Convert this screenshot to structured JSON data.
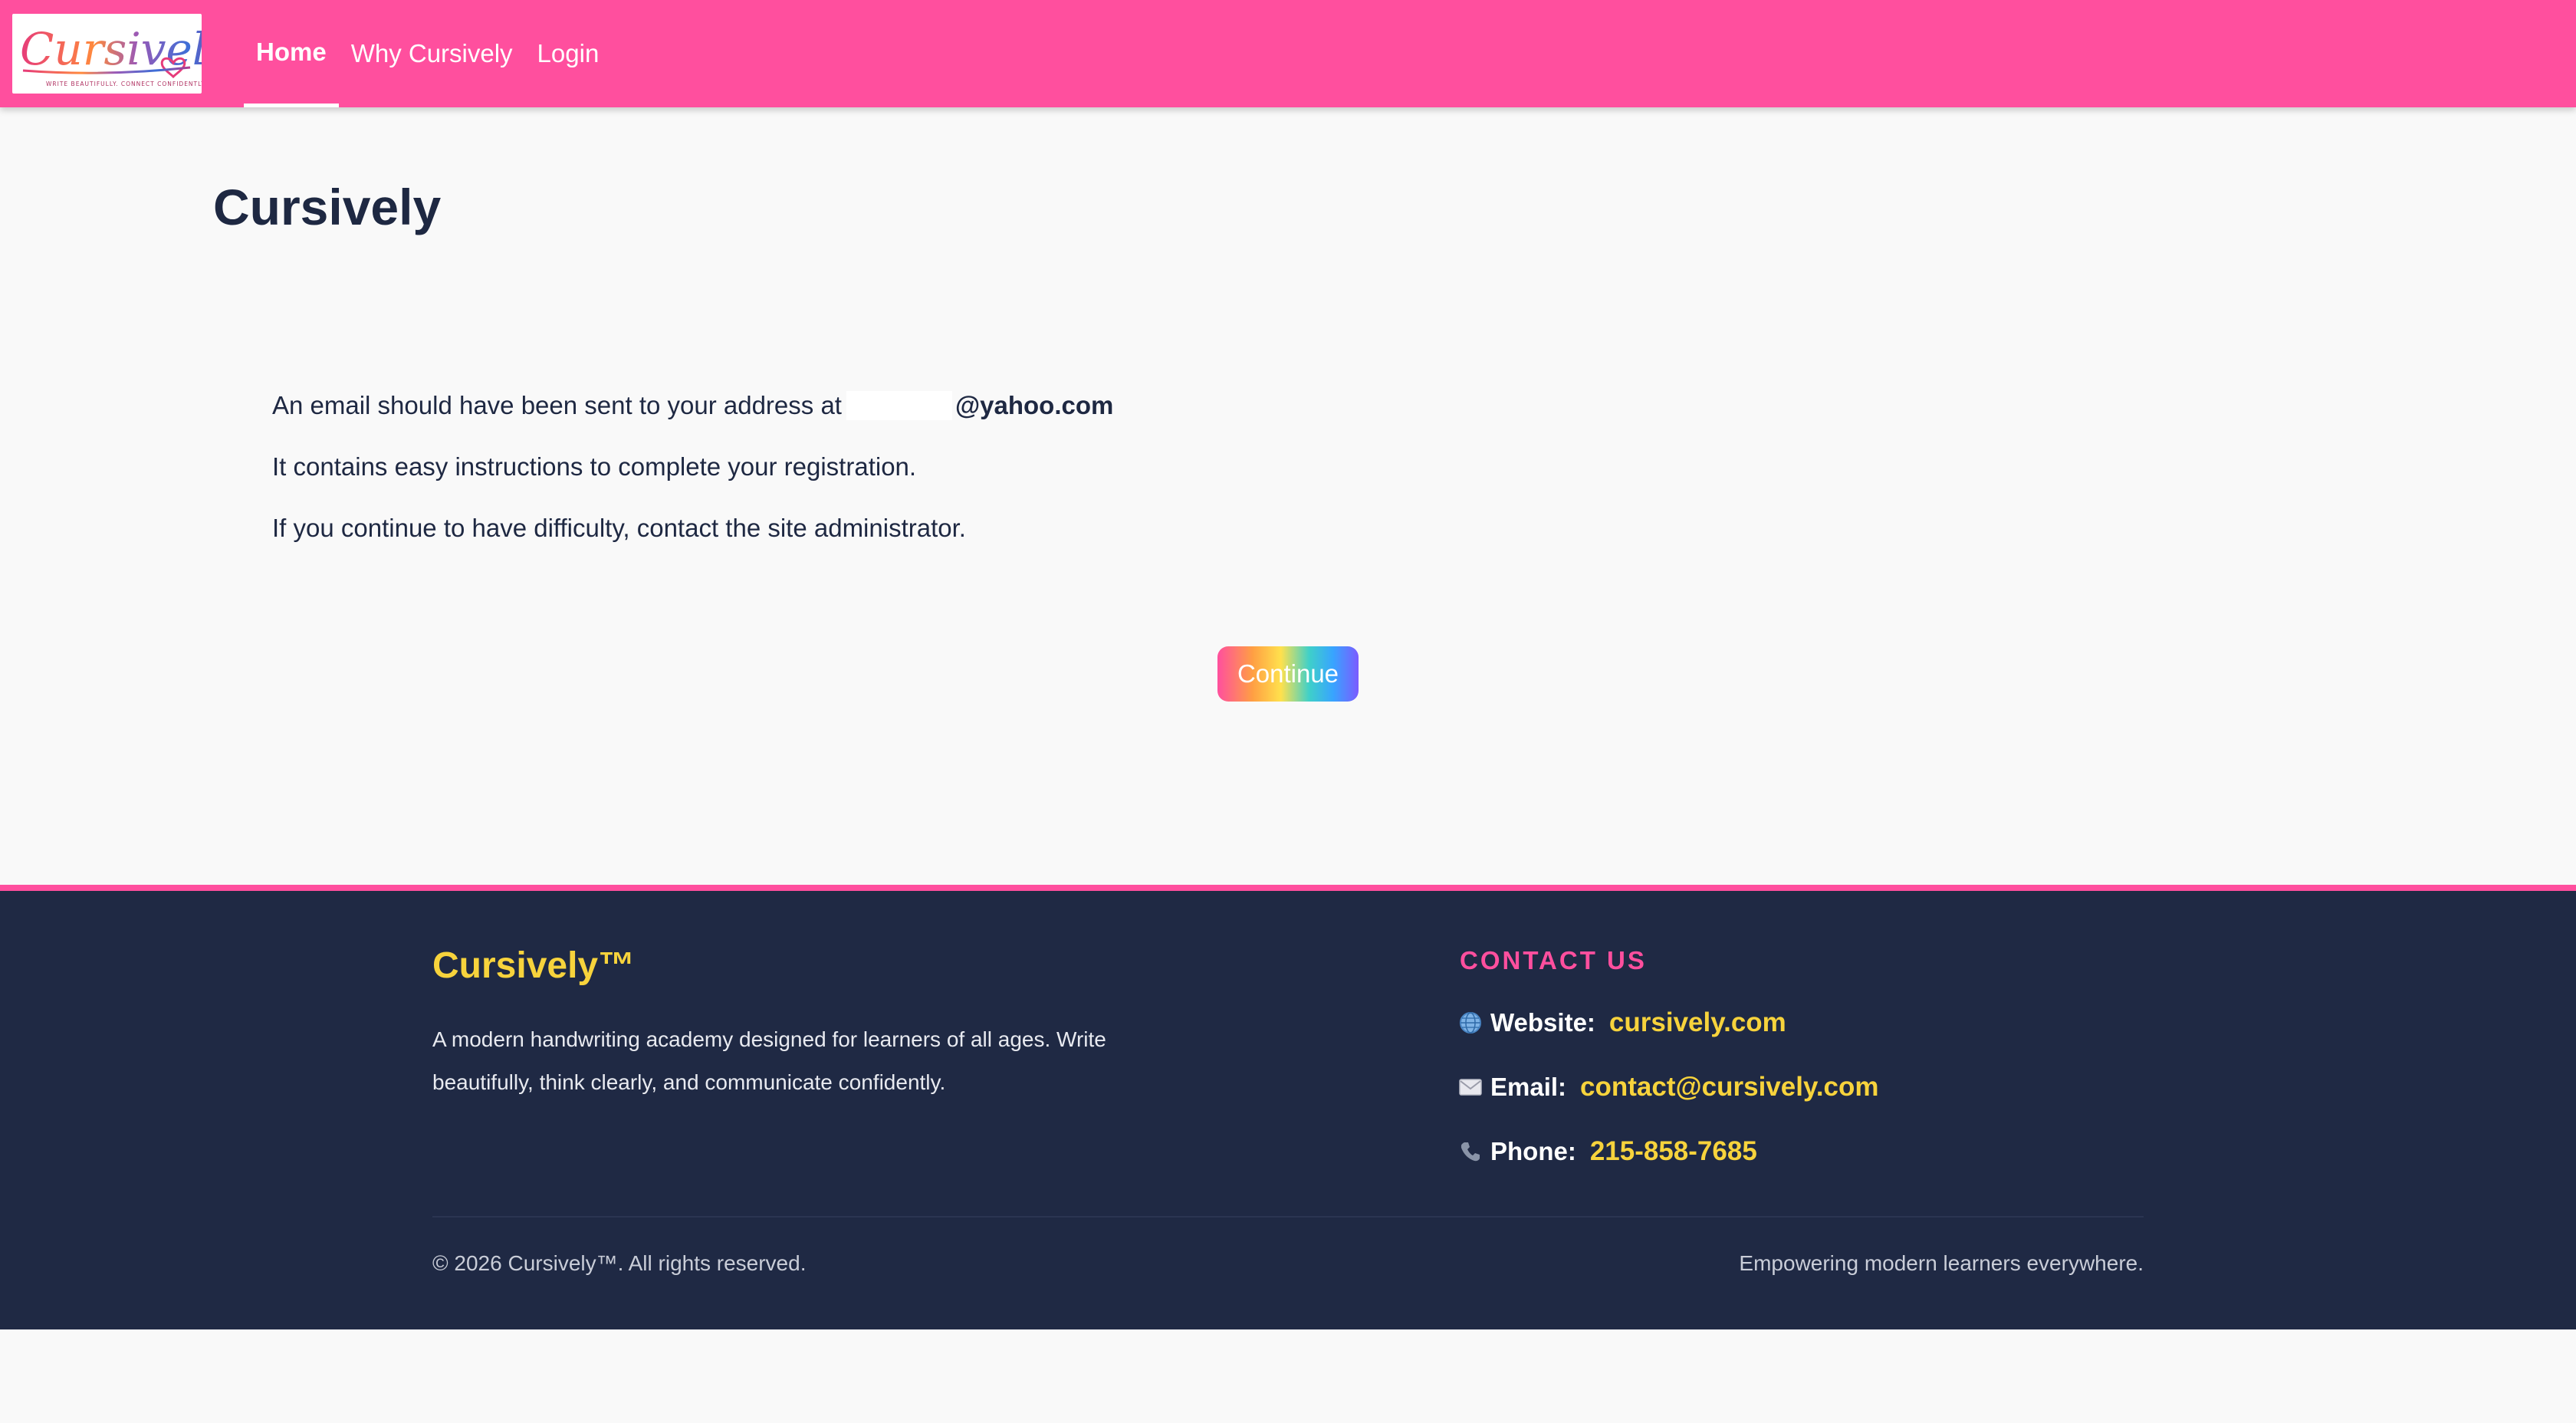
{
  "header": {
    "logo_text": "Cursively",
    "logo_tagline": "WRITE BEAUTIFULLY. CONNECT CONFIDENTLY.",
    "nav": [
      {
        "label": "Home",
        "active": true
      },
      {
        "label": "Why Cursively",
        "active": false
      },
      {
        "label": "Login",
        "active": false
      }
    ]
  },
  "main": {
    "title": "Cursively",
    "message_line1_prefix": "An email should have been sent to your address at",
    "message_line1_email_domain": "@yahoo.com",
    "message_line2": "It contains easy instructions to complete your registration.",
    "message_line3": "If you continue to have difficulty, contact the site administrator.",
    "continue_label": "Continue"
  },
  "footer": {
    "brand": "Cursively™",
    "description": "A modern handwriting academy designed for learners of all ages. Write beautifully, think clearly, and communicate confidently.",
    "contact_title": "CONTACT US",
    "contacts": [
      {
        "icon": "globe-icon",
        "label": "Website:",
        "value": "cursively.com"
      },
      {
        "icon": "envelope-icon",
        "label": "Email:",
        "value": "contact@cursively.com"
      },
      {
        "icon": "phone-icon",
        "label": "Phone:",
        "value": "215-858-7685"
      }
    ],
    "copyright": "© 2026 Cursively™. All rights reserved.",
    "tagline": "Empowering modern learners everywhere."
  },
  "colors": {
    "header_bg": "#ff4f9e",
    "footer_bg": "#1f2944",
    "accent_yellow": "#f7d33c",
    "text_dark": "#1e2842"
  }
}
